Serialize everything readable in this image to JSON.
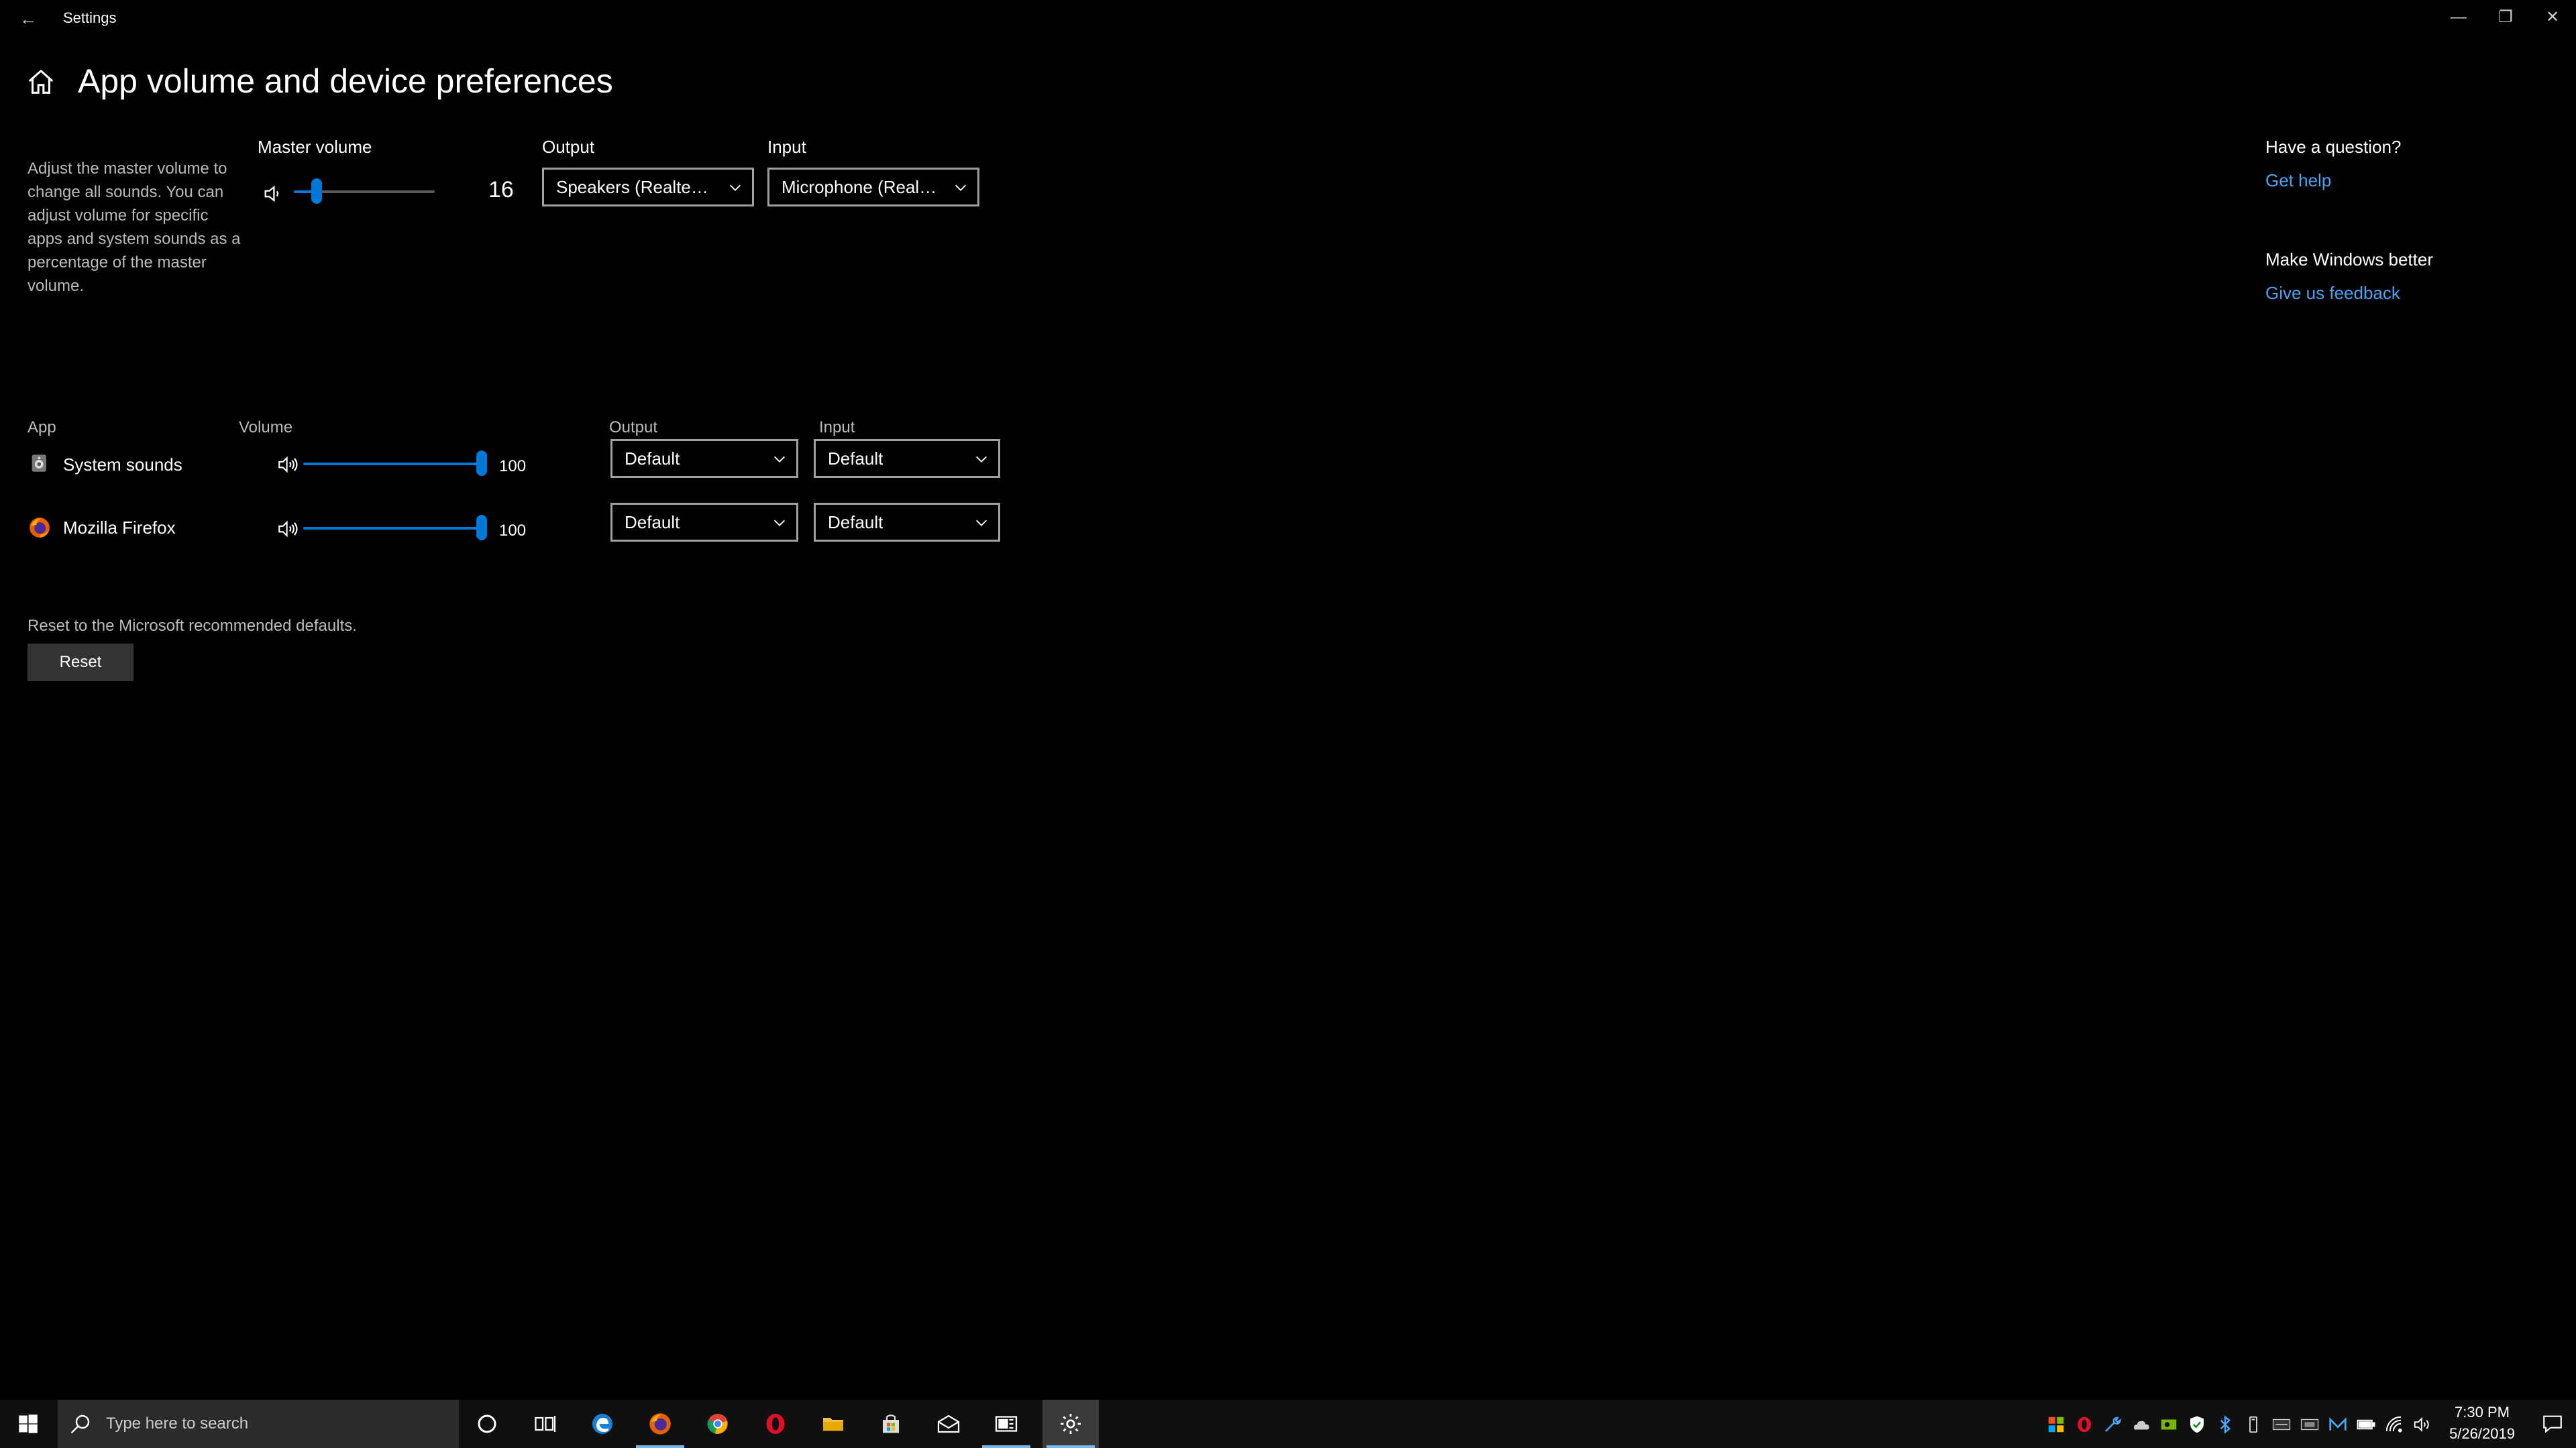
{
  "window": {
    "title": "Settings",
    "back_glyph": "←",
    "min_glyph": "—",
    "restore_glyph": "❐",
    "close_glyph": "✕"
  },
  "page": {
    "title": "App volume and device preferences",
    "description": "Adjust the master volume to change all sounds. You can adjust volume for specific apps and system sounds as a percentage of the master volume."
  },
  "master": {
    "label": "Master volume",
    "value": "16",
    "level": 16
  },
  "device": {
    "output_label": "Output",
    "input_label": "Input",
    "output_value": "Speakers (Realtek...",
    "input_value": "Microphone (Realt..."
  },
  "help": {
    "question_heading": "Have a question?",
    "get_help_link": "Get help",
    "better_heading": "Make Windows better",
    "feedback_link": "Give us feedback"
  },
  "apps": {
    "columns": {
      "app": "App",
      "volume": "Volume",
      "output": "Output",
      "input": "Input"
    },
    "rows": [
      {
        "name": "System sounds",
        "volume": "100",
        "level": 100,
        "output": "Default",
        "input": "Default"
      },
      {
        "name": "Mozilla Firefox",
        "volume": "100",
        "level": 100,
        "output": "Default",
        "input": "Default"
      }
    ]
  },
  "reset": {
    "text": "Reset to the Microsoft recommended defaults.",
    "button_label": "Reset"
  },
  "taskbar": {
    "search_placeholder": "Type here to search",
    "time": "7:30 PM",
    "date": "5/26/2019",
    "pinned": [
      "cortana-icon",
      "task-view-icon",
      "edge-icon",
      "firefox-icon",
      "chrome-icon",
      "opera-icon",
      "file-explorer-icon",
      "store-icon",
      "mail-icon",
      "news-icon",
      "settings-icon"
    ]
  },
  "colors": {
    "accent": "#0078d7",
    "link": "#4aa3f0",
    "background": "#000000"
  }
}
